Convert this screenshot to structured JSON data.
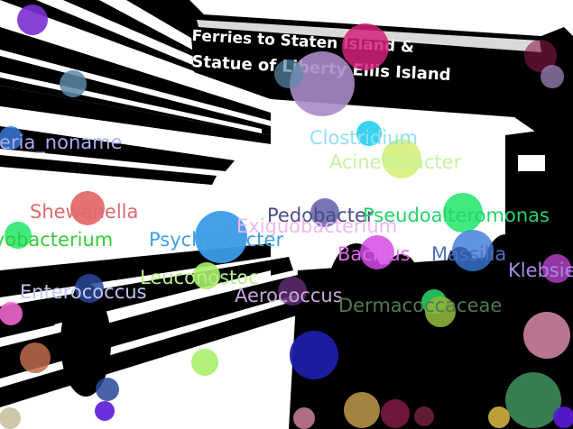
{
  "sign": {
    "line1": "Ferries to Staten Island &",
    "line2": "Statue of Liberty Ellis Island"
  },
  "taxa": [
    {
      "text": "Bacteria_noname",
      "color": "#a9aef0"
    },
    {
      "text": "Clostridium",
      "color": "#8fe0f2"
    },
    {
      "text": "Acinetobacter",
      "color": "#c6f2a0"
    },
    {
      "text": "Shewanella",
      "color": "#e06870"
    },
    {
      "text": "Pedobacter",
      "color": "#4a4a86"
    },
    {
      "text": "Pseudoalteromonas",
      "color": "#22d46a"
    },
    {
      "text": "Exiguobacterium",
      "color": "#f0b8ec"
    },
    {
      "text": "Psychrobacter",
      "color": "#3f9fe3"
    },
    {
      "text": "Flavobacterium",
      "color": "#35cc3a"
    },
    {
      "text": "Bacillus",
      "color": "#df6ae6"
    },
    {
      "text": "Massilia",
      "color": "#5070c0"
    },
    {
      "text": "Leuconostoc",
      "color": "#b8ee8a"
    },
    {
      "text": "Klebsiella",
      "color": "#a98be6"
    },
    {
      "text": "Enterococcus",
      "color": "#c2c6f0"
    },
    {
      "text": "Aerococcus",
      "color": "#c8a8dc"
    },
    {
      "text": "Dermacoccaceae",
      "color": "#4f7a4f"
    }
  ],
  "dot_colors": {
    "purple": "#7b2fd1",
    "steel": "#5a8aa8",
    "magenta": "#d4217a",
    "lavender": "#a98bc8",
    "navy": "#29489a",
    "cyan": "#2fd0f0",
    "lime": "#d4f07a",
    "red": "#e05a5a",
    "blue": "#3a9be8",
    "slate": "#4a4aa0",
    "green": "#2ce870",
    "violet": "#d44ae8",
    "royal": "#3a78d8",
    "pale_green": "#a8ee6a",
    "plum": "#5a2a6a",
    "pink": "#ee66cc",
    "indigo": "#1e1ea8",
    "rose": "#d88aa8",
    "olive": "#8cb43a",
    "brown": "#c06a4a",
    "gold": "#c09a4a",
    "maroon": "#8a1a4a",
    "teal_green": "#3e8a5a",
    "amber": "#d0b040",
    "dark_violet": "#5a1ad8",
    "sand": "#c8c0a0",
    "wine": "#8a2a4a"
  }
}
